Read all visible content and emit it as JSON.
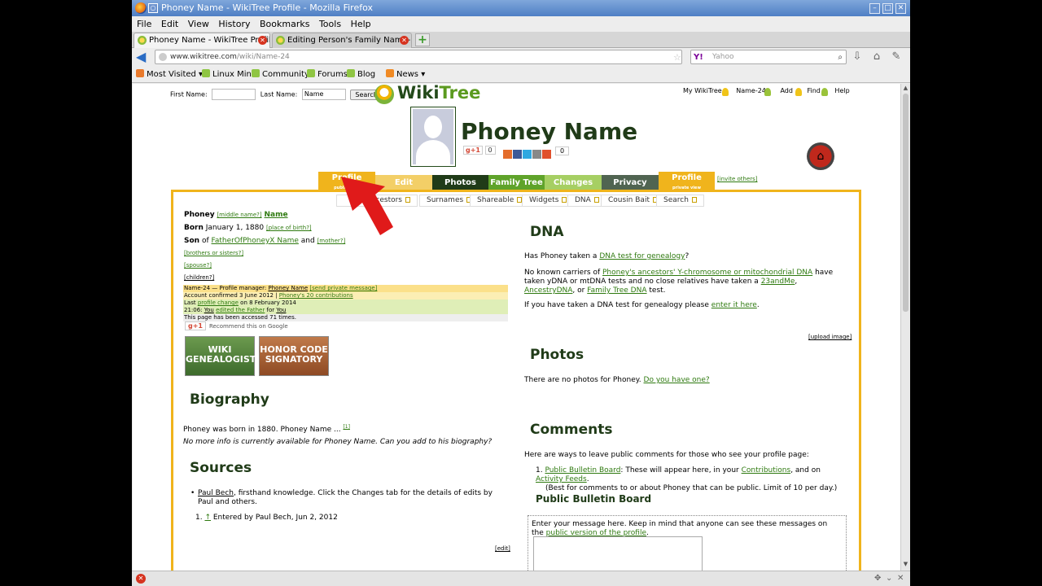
{
  "window": {
    "title": "Phoney Name - WikiTree Profile - Mozilla Firefox"
  },
  "menu": [
    "File",
    "Edit",
    "View",
    "History",
    "Bookmarks",
    "Tools",
    "Help"
  ],
  "tabs": [
    {
      "label": "Phoney Name - WikiTree Profile"
    },
    {
      "label": "Editing Person's Family Name-2..."
    }
  ],
  "url": {
    "domain": "www.wikitree.com",
    "path": "/wiki/Name-24"
  },
  "search": {
    "placeholder": "Yahoo"
  },
  "bookmarks": [
    "Most Visited",
    "Linux Mint",
    "Community",
    "Forums",
    "Blog",
    "News"
  ],
  "topform": {
    "first_label": "First Name:",
    "last_label": "Last Name:",
    "last_value": "Name",
    "search_btn": "Search"
  },
  "logo": {
    "a": "Wiki",
    "b": "Tree"
  },
  "usermenu": [
    "My WikiTree",
    "Name-24",
    "Add",
    "Find",
    "Help"
  ],
  "profile": {
    "name": "Phoney Name",
    "gplus": "g+1",
    "gcount": "0",
    "sharecount": "0"
  },
  "ptabs": {
    "profile": "Profile",
    "profile_sub": "public view",
    "edit": "Edit",
    "photos": "Photos",
    "family": "Family Tree",
    "changes": "Changes",
    "privacy": "Privacy",
    "profile2": "Profile",
    "profile2_sub": "private view",
    "invite": "[invite others]"
  },
  "subnav": [
    "Ancestors",
    "Surnames",
    "Shareable",
    "Widgets",
    "DNA",
    "Cousin Bait",
    "Search"
  ],
  "colors": {
    "accent": "#f0b41c",
    "green": "#2f7a10",
    "dark": "#203b18"
  },
  "left": {
    "first": "Phoney",
    "middle": "[middle name?]",
    "last": "Name",
    "born_label": "Born",
    "born_date": "January 1, 1880",
    "birth_place": "[place of birth?]",
    "son_label": "Son",
    "of": "of",
    "father": "FatherOfPhoneyX Name",
    "and": "and",
    "mother": "[mother?]",
    "siblings": "[brothers or sisters?]",
    "spouse": "[spouse?]",
    "children": "[children?]",
    "mgr1a": "Name-24 — Profile manager:",
    "mgr1b": "Phoney Name",
    "mgr1c": "[send private message]",
    "mgr2a": "Account confirmed 3 June 2012 |",
    "mgr2b": "Phoney's 20 contributions",
    "mgr3a": "Last",
    "mgr3b": "profile change",
    "mgr3c": "on 8 February 2014",
    "mgr4a": "21:06:",
    "mgr4b": "You",
    "mgr4c": "edited the Father",
    "mgr4d": "for",
    "mgr4e": "You",
    "mgr5": "This page has been accessed 71 times.",
    "recommend": "Recommend this on Google",
    "badge1": "WIKI GENEALOGIST",
    "badge2": "HONOR CODE SIGNATORY",
    "bio_title": "Biography",
    "bio_text": "Phoney was born in 1880. Phoney Name ...",
    "bio_ref": "[1]",
    "bio_note": "No more info is currently available for Phoney Name. Can you add to his biography?",
    "sources_title": "Sources",
    "source_name": "Paul Bech",
    "source_text": ", firsthand knowledge. Click the Changes tab for the details of edits by Paul and others.",
    "ref_mark": "↑",
    "ref_text": "Entered by Paul Bech, Jun 2, 2012",
    "edit": "[edit]"
  },
  "right": {
    "dna_title": "DNA",
    "dna_q": "Has Phoney taken a",
    "dna_q_link": "DNA test for genealogy",
    "dna_q_end": "?",
    "dna_p1a": "No known carriers of",
    "dna_p1b": "Phoney's ancestors' Y-chromosome or mitochondrial DNA",
    "dna_p1c": "have taken yDNA or mtDNA tests and no close relatives have taken a",
    "dna_p1d": "23andMe",
    "dna_p1e": "AncestryDNA",
    "dna_p1f": "or",
    "dna_p1g": "Family Tree DNA",
    "dna_p1h": "test.",
    "dna_p2a": "If you have taken a DNA test for genealogy please",
    "dna_p2b": "enter it here",
    "upload": "[upload image]",
    "photos_title": "Photos",
    "photos_text": "There are no photos for Phoney.",
    "photos_link": "Do you have one?",
    "comments_title": "Comments",
    "comments_text": "Here are ways to leave public comments for those who see your profile page:",
    "c1a": "Public Bulletin Board",
    "c1b": ": These will appear here, in your",
    "c1c": "Contributions",
    "c1d": ", and on",
    "c1e": "Activity Feeds",
    "c1f": "(Best for comments to or about Phoney that can be public. Limit of 10 per day.)",
    "pbb_title": "Public Bulletin Board",
    "pbb_text": "Enter your message here. Keep in mind that anyone can see these messages on the",
    "pbb_link": "public version of the profile"
  }
}
